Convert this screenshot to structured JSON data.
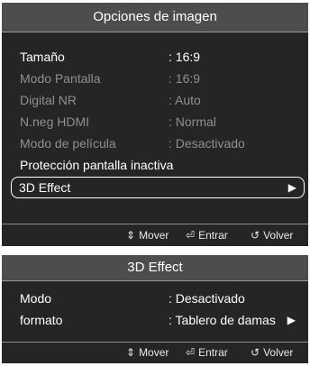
{
  "picture_options": {
    "title": "Opciones de imagen",
    "items": [
      {
        "label": "Tamaño",
        "value": ": 16:9"
      },
      {
        "label": "Modo Pantalla",
        "value": ": 16:9"
      },
      {
        "label": "Digital NR",
        "value": ": Auto"
      },
      {
        "label": "N.neg HDMI",
        "value": ": Normal"
      },
      {
        "label": "Modo de película",
        "value": ": Desactivado"
      },
      {
        "label": "Protección pantalla inactiva"
      },
      {
        "label": "3D Effect",
        "icon": "right-triangle-arrow-icon"
      }
    ],
    "footer": {
      "move": "Mover",
      "enter": "Entrar",
      "back": "Volver"
    }
  },
  "effect_3d": {
    "title": "3D Effect",
    "items": [
      {
        "label": "Modo",
        "value": ": Desactivado"
      },
      {
        "label": "formato",
        "value": ": Tablero de damas",
        "icon": "right-triangle-arrow-icon"
      }
    ],
    "footer": {
      "move": "Mover",
      "enter": "Entrar",
      "back": "Volver"
    }
  },
  "colors": {
    "panel_bg": "#252525",
    "title_bg": "#4d4d4d",
    "disabled_text": "#8f8f8f"
  }
}
